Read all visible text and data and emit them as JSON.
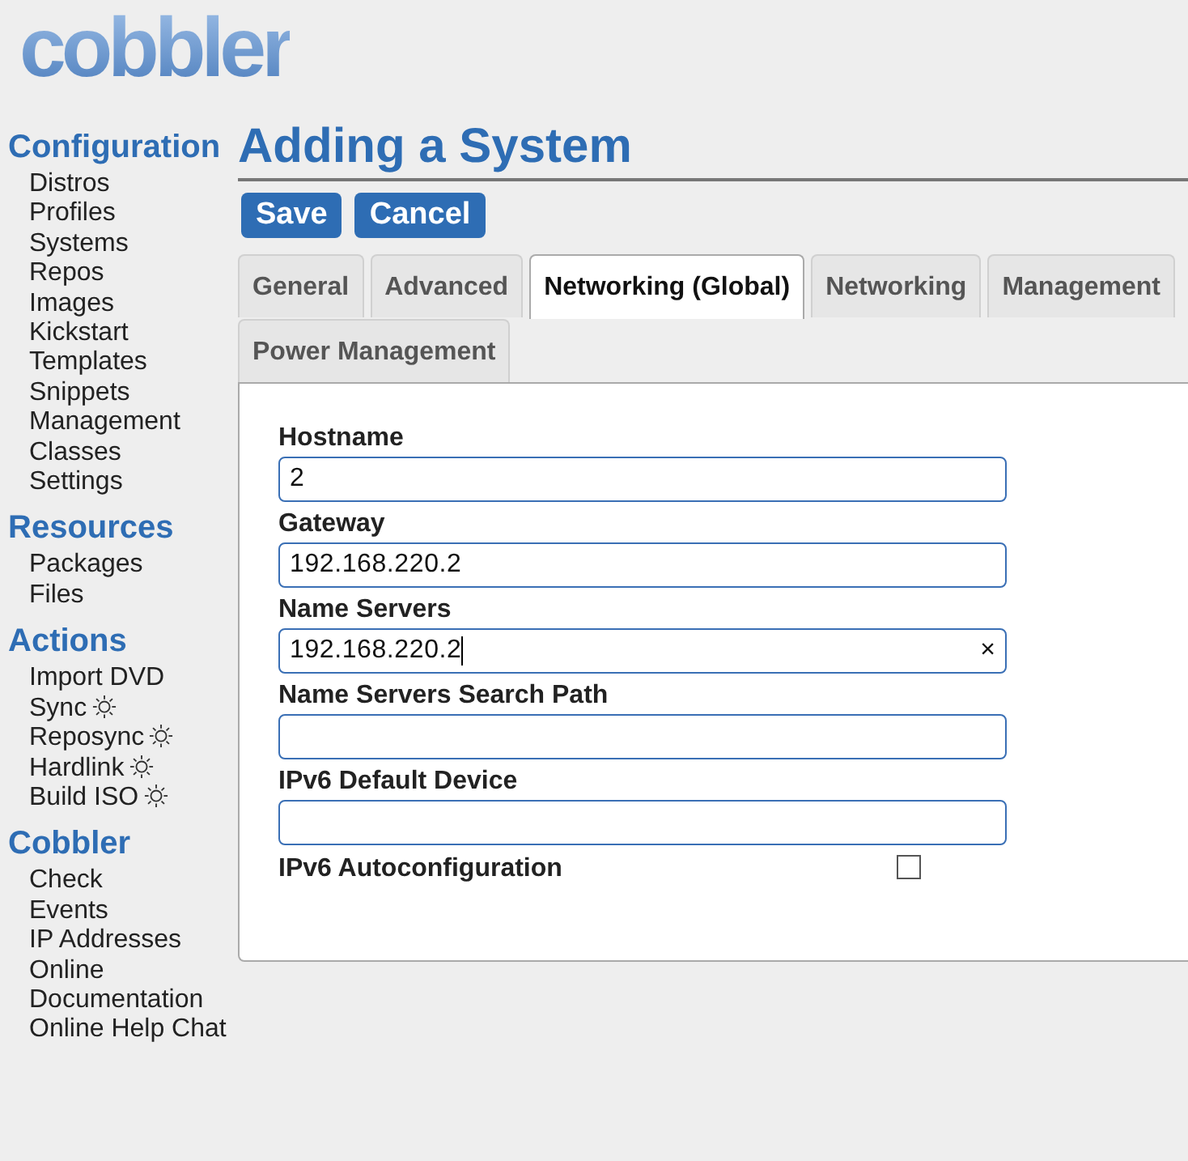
{
  "logo": "cobbler",
  "sidebar": [
    {
      "heading": "Configuration",
      "items": [
        {
          "label": "Distros"
        },
        {
          "label": "Profiles"
        },
        {
          "label": "Systems"
        },
        {
          "label": "Repos"
        },
        {
          "label": "Images"
        },
        {
          "label": "Kickstart"
        },
        {
          "label": "Templates"
        },
        {
          "label": "Snippets"
        },
        {
          "label": "Management"
        },
        {
          "label": "Classes"
        },
        {
          "label": "Settings"
        }
      ]
    },
    {
      "heading": "Resources",
      "items": [
        {
          "label": "Packages"
        },
        {
          "label": "Files"
        }
      ]
    },
    {
      "heading": "Actions",
      "items": [
        {
          "label": "Import DVD",
          "task": false
        },
        {
          "label": "Sync",
          "task": true
        },
        {
          "label": "Reposync",
          "task": true
        },
        {
          "label": "Hardlink",
          "task": true
        },
        {
          "label": "Build ISO",
          "task": true
        }
      ]
    },
    {
      "heading": "Cobbler",
      "items": [
        {
          "label": "Check"
        },
        {
          "label": "Events"
        },
        {
          "label": "IP Addresses"
        },
        {
          "label": "Online"
        },
        {
          "label": "Documentation"
        },
        {
          "label": "Online Help Chat"
        }
      ]
    }
  ],
  "page_title": "Adding a System",
  "buttons": [
    "Save",
    "Cancel"
  ],
  "tabs": [
    {
      "label": "General",
      "selected": false
    },
    {
      "label": "Advanced",
      "selected": false
    },
    {
      "label": "Networking (Global)",
      "selected": true
    },
    {
      "label": "Networking",
      "selected": false
    },
    {
      "label": "Management",
      "selected": false
    },
    {
      "label": "Power Management",
      "selected": false
    }
  ],
  "fields": [
    {
      "kind": "text",
      "label": "Hostname",
      "value": "2"
    },
    {
      "kind": "text",
      "label": "Gateway",
      "value": "192.168.220.2"
    },
    {
      "kind": "text",
      "label": "Name Servers",
      "value": "192.168.220.2",
      "clear_button": "×"
    },
    {
      "kind": "text",
      "label": "Name Servers Search Path"
    },
    {
      "kind": "text",
      "label": "IPv6 Default Device"
    },
    {
      "kind": "checkbox",
      "label": "IPv6 Autoconfiguration",
      "checked": false
    }
  ]
}
